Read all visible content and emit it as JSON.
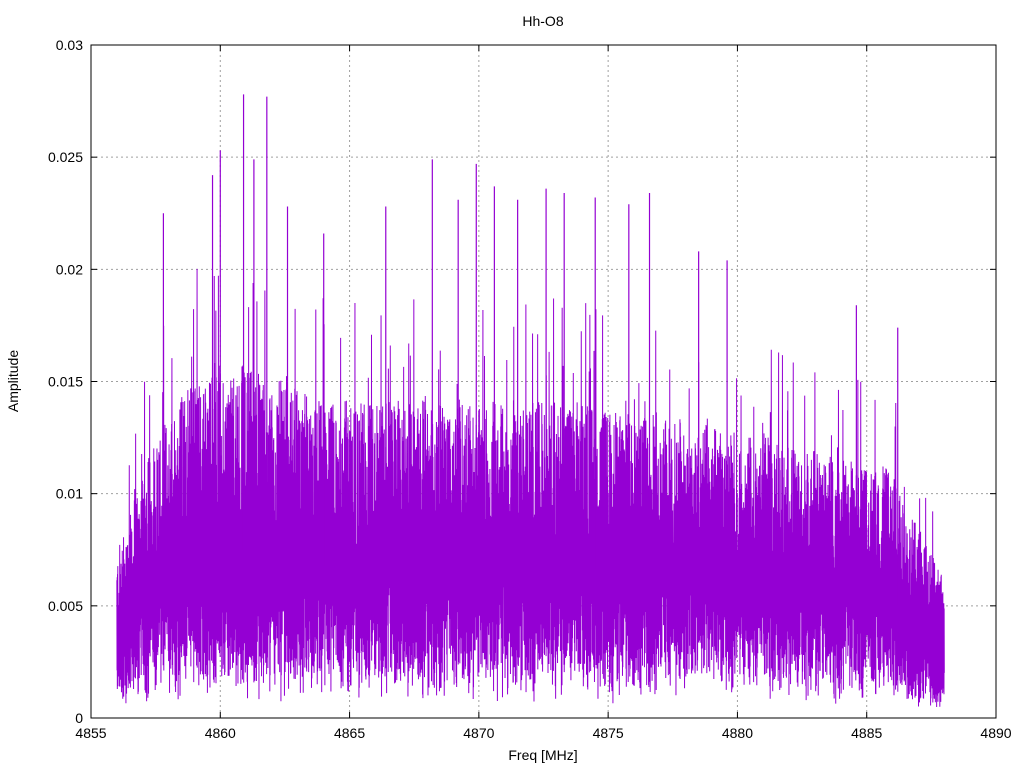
{
  "chart_data": {
    "type": "line",
    "title": "Hh-O8",
    "xlabel": "Freq [MHz]",
    "ylabel": "Amplitude",
    "xlim": [
      4855,
      4890
    ],
    "ylim": [
      0,
      0.03
    ],
    "x_ticks": [
      "4855",
      "4860",
      "4865",
      "4870",
      "4875",
      "4880",
      "4885",
      "4890"
    ],
    "y_ticks": [
      "0",
      "0.005",
      "0.01",
      "0.015",
      "0.02",
      "0.025",
      "0.03"
    ],
    "grid": true,
    "legend": "none",
    "series_color": "#9400d3",
    "series": [
      {
        "x_range": [
          4856.0,
          4888.0
        ],
        "envelope": {
          "x": [
            4856.0,
            4857.0,
            4858.0,
            4859.0,
            4860.0,
            4861.0,
            4862.0,
            4863.0,
            4864.0,
            4865.0,
            4866.0,
            4867.0,
            4868.0,
            4869.0,
            4870.0,
            4871.0,
            4872.0,
            4873.0,
            4874.0,
            4875.0,
            4876.0,
            4877.0,
            4878.0,
            4879.0,
            4880.0,
            4881.0,
            4882.0,
            4883.0,
            4884.0,
            4885.0,
            4886.0,
            4887.0,
            4888.0
          ],
          "typical_high": [
            0.007,
            0.011,
            0.013,
            0.0145,
            0.015,
            0.015,
            0.0145,
            0.014,
            0.0135,
            0.0135,
            0.0135,
            0.0135,
            0.0135,
            0.0135,
            0.0135,
            0.0135,
            0.0135,
            0.0135,
            0.0135,
            0.013,
            0.013,
            0.013,
            0.0125,
            0.0125,
            0.012,
            0.012,
            0.0115,
            0.0115,
            0.011,
            0.011,
            0.0105,
            0.008,
            0.006
          ],
          "typical_low": [
            0.001,
            0.0025,
            0.003,
            0.003,
            0.003,
            0.003,
            0.003,
            0.003,
            0.003,
            0.003,
            0.003,
            0.003,
            0.003,
            0.003,
            0.003,
            0.003,
            0.003,
            0.003,
            0.003,
            0.003,
            0.003,
            0.003,
            0.003,
            0.003,
            0.003,
            0.003,
            0.003,
            0.003,
            0.003,
            0.003,
            0.0025,
            0.0015,
            0.0008
          ]
        },
        "peaks": [
          {
            "x": 4857.8,
            "y": 0.0225
          },
          {
            "x": 4859.7,
            "y": 0.0242
          },
          {
            "x": 4860.0,
            "y": 0.0253
          },
          {
            "x": 4860.9,
            "y": 0.0278
          },
          {
            "x": 4861.3,
            "y": 0.0249
          },
          {
            "x": 4861.8,
            "y": 0.0277
          },
          {
            "x": 4862.6,
            "y": 0.0228
          },
          {
            "x": 4864.0,
            "y": 0.0216
          },
          {
            "x": 4866.4,
            "y": 0.0228
          },
          {
            "x": 4868.2,
            "y": 0.0249
          },
          {
            "x": 4869.2,
            "y": 0.0231
          },
          {
            "x": 4869.9,
            "y": 0.0247
          },
          {
            "x": 4870.6,
            "y": 0.0237
          },
          {
            "x": 4871.5,
            "y": 0.0231
          },
          {
            "x": 4872.6,
            "y": 0.0236
          },
          {
            "x": 4873.3,
            "y": 0.0234
          },
          {
            "x": 4874.5,
            "y": 0.0232
          },
          {
            "x": 4875.8,
            "y": 0.0229
          },
          {
            "x": 4876.6,
            "y": 0.0234
          },
          {
            "x": 4878.5,
            "y": 0.0208
          },
          {
            "x": 4879.6,
            "y": 0.0204
          },
          {
            "x": 4884.6,
            "y": 0.0184
          },
          {
            "x": 4886.2,
            "y": 0.0174
          }
        ]
      }
    ]
  }
}
